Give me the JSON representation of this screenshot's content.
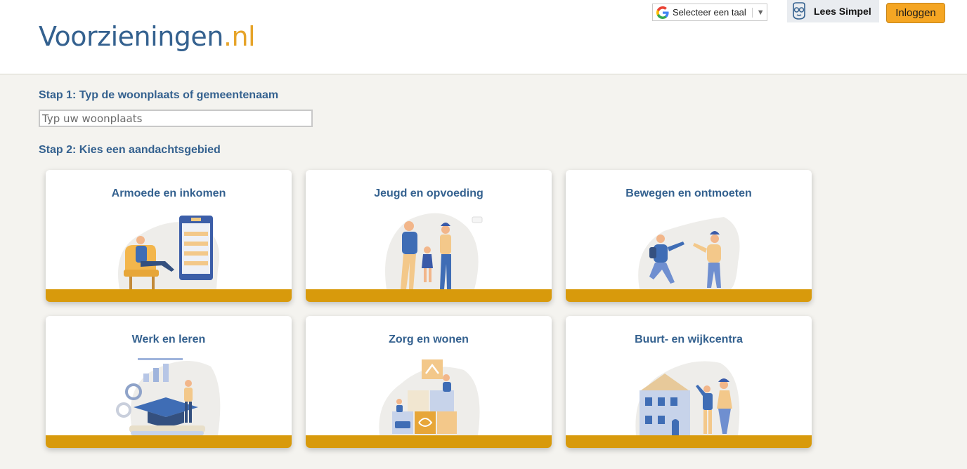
{
  "header": {
    "logo_main": "Voorzieningen",
    "logo_tld": ".nl",
    "translate_label": "Selecteer een taal",
    "translate_arrow": "▼",
    "lees_simpel_label": "Lees Simpel",
    "login_label": "Inloggen"
  },
  "search": {
    "step1_label": "Stap 1: Typ de woonplaats of gemeentenaam",
    "placeholder": "Typ uw woonplaats",
    "step2_label": "Stap 2: Kies een aandachtsgebied"
  },
  "cards": [
    {
      "title": "Armoede en inkomen",
      "icon": "poverty-income-illustration"
    },
    {
      "title": "Jeugd en opvoeding",
      "icon": "youth-parenting-illustration"
    },
    {
      "title": "Bewegen en ontmoeten",
      "icon": "exercise-meeting-illustration"
    },
    {
      "title": "Werk en leren",
      "icon": "work-learning-illustration"
    },
    {
      "title": "Zorg en wonen",
      "icon": "care-housing-illustration"
    },
    {
      "title": "Buurt- en wijkcentra",
      "icon": "community-centers-illustration"
    }
  ],
  "colors": {
    "brand_blue": "#34618f",
    "brand_orange": "#e6a42a",
    "card_bar": "#d89a0c",
    "login_button": "#f5a623",
    "page_background": "#f4f3ef"
  }
}
